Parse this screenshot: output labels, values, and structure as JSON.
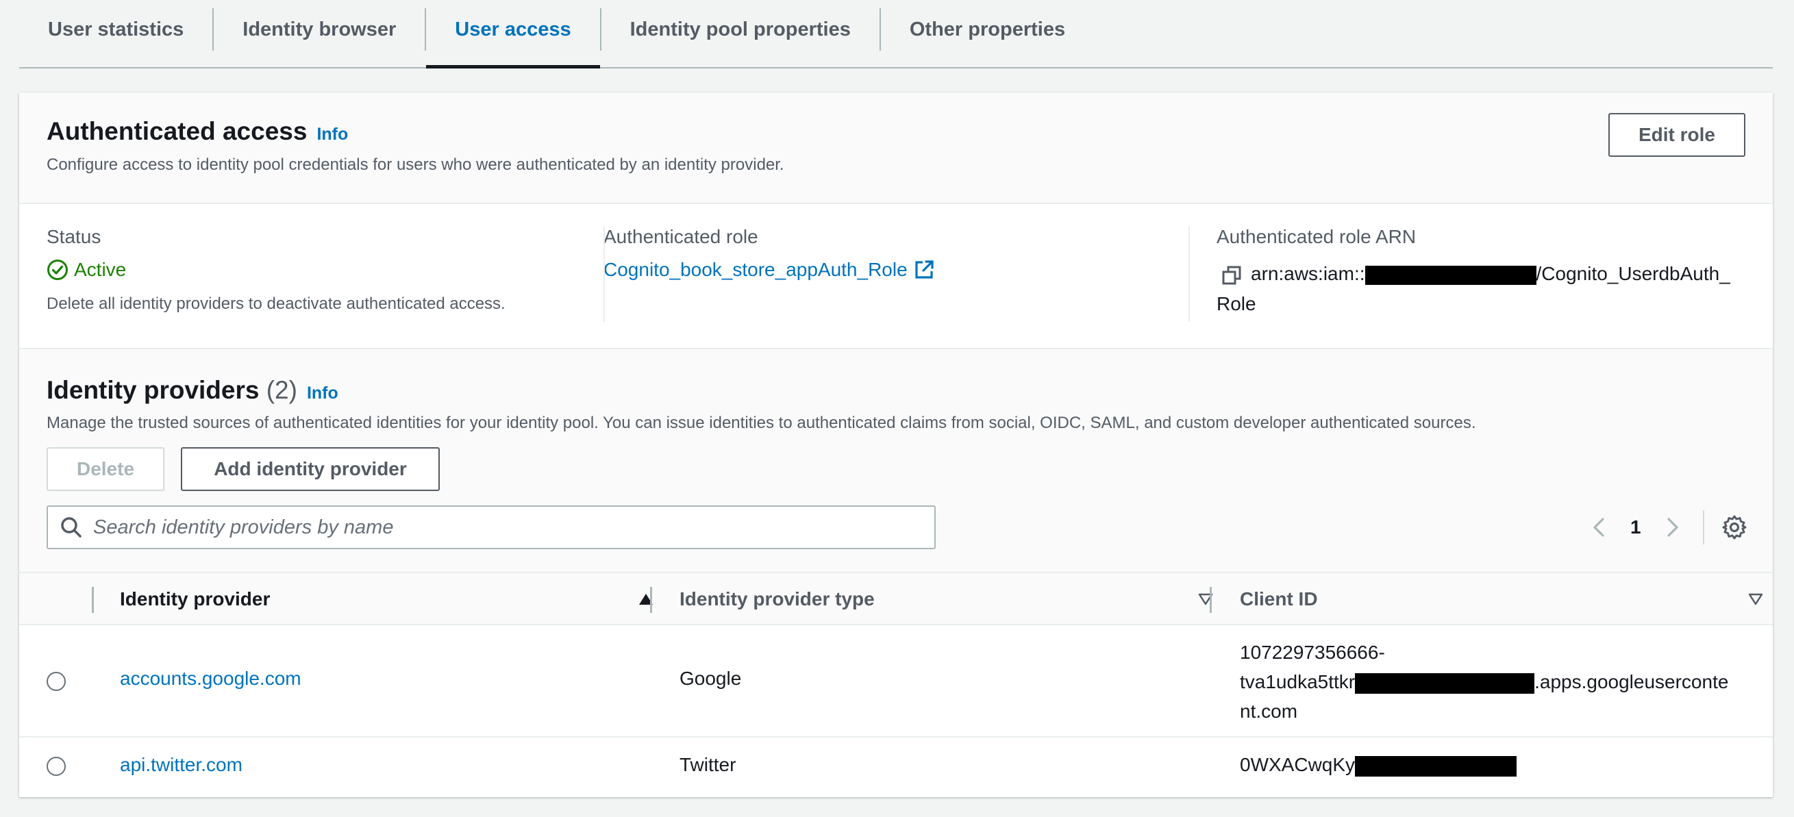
{
  "tabs": [
    {
      "label": "User statistics"
    },
    {
      "label": "Identity browser"
    },
    {
      "label": "User access"
    },
    {
      "label": "Identity pool properties"
    },
    {
      "label": "Other properties"
    }
  ],
  "auth_access": {
    "title": "Authenticated access",
    "info": "Info",
    "description": "Configure access to identity pool credentials for users who were authenticated by an identity provider.",
    "edit_button": "Edit role",
    "status_label": "Status",
    "status_value": "Active",
    "status_note": "Delete all identity providers to deactivate authenticated access.",
    "role_label": "Authenticated role",
    "role_value": "Cognito_book_store_appAuth_Role",
    "arn_label": "Authenticated role ARN",
    "arn_prefix": "arn:aws:iam::",
    "arn_suffix": "/Cognito_UserdbAuth_",
    "arn_line2": "Role"
  },
  "identity_providers": {
    "title": "Identity providers",
    "count": "(2)",
    "info": "Info",
    "description": "Manage the trusted sources of authenticated identities for your identity pool. You can issue identities to authenticated claims from social, OIDC, SAML, and custom developer authenticated sources.",
    "delete_button": "Delete",
    "add_button": "Add identity provider",
    "search_placeholder": "Search identity providers by name",
    "page_number": "1",
    "columns": {
      "provider": "Identity provider",
      "type": "Identity provider type",
      "client_id": "Client ID"
    },
    "rows": [
      {
        "provider": "accounts.google.com",
        "type": "Google",
        "client_id_line1": "1072297356666-",
        "client_id_line2_prefix": "tva1udka5ttkr",
        "client_id_line2_suffix": ".apps.googleuserconte",
        "client_id_line3": "nt.com"
      },
      {
        "provider": "api.twitter.com",
        "type": "Twitter",
        "client_id_prefix": "0WXACwqKy"
      }
    ]
  },
  "colors": {
    "accent": "#0073bb",
    "success": "#1d8102",
    "text": "#16191f",
    "muted": "#545b64"
  }
}
